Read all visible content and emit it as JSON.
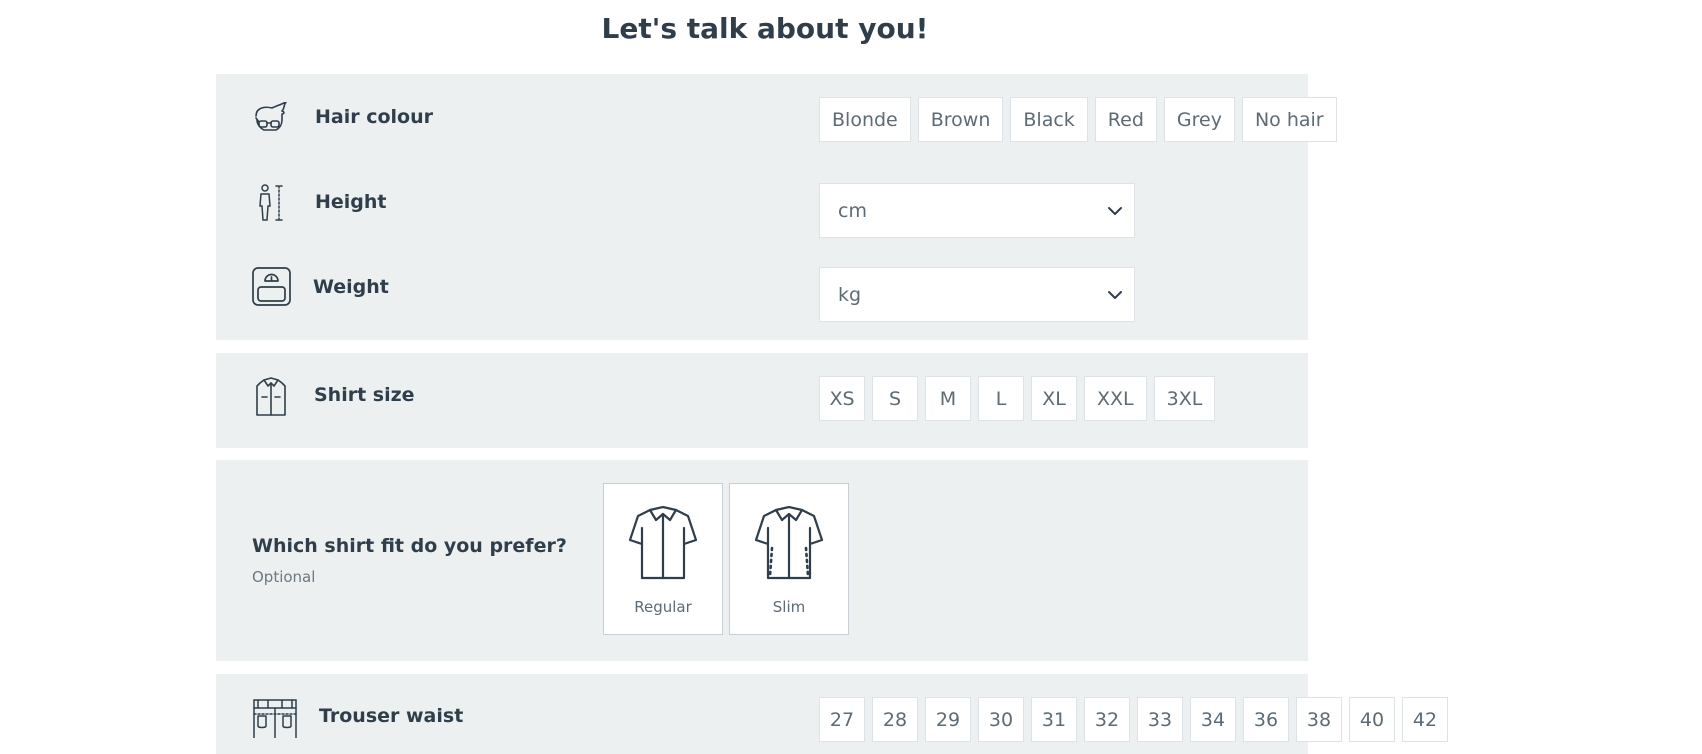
{
  "page": {
    "title": "Let's talk about you!"
  },
  "hair": {
    "label": "Hair colour",
    "options": [
      "Blonde",
      "Brown",
      "Black",
      "Red",
      "Grey",
      "No hair"
    ]
  },
  "height": {
    "label": "Height",
    "unit": "cm"
  },
  "weight": {
    "label": "Weight",
    "unit": "kg"
  },
  "shirt_size": {
    "label": "Shirt size",
    "options": [
      "XS",
      "S",
      "M",
      "L",
      "XL",
      "XXL",
      "3XL"
    ]
  },
  "shirt_fit": {
    "question": "Which shirt fit do you prefer?",
    "optional_label": "Optional",
    "options": [
      "Regular",
      "Slim"
    ]
  },
  "trouser_waist": {
    "label": "Trouser waist",
    "options": [
      "27",
      "28",
      "29",
      "30",
      "31",
      "32",
      "33",
      "34",
      "36",
      "38",
      "40",
      "42"
    ]
  },
  "colors": {
    "panel_bg": "#edf0f1",
    "text_dark": "#2f3e4a",
    "text_muted": "#5d6b75",
    "chip_border": "#dde3e6"
  },
  "icons": {
    "hair": "hair-glasses-icon",
    "height": "person-height-icon",
    "weight": "scale-icon",
    "shirt": "shirt-icon",
    "trousers": "trousers-icon",
    "chevron": "chevron-down-icon"
  }
}
